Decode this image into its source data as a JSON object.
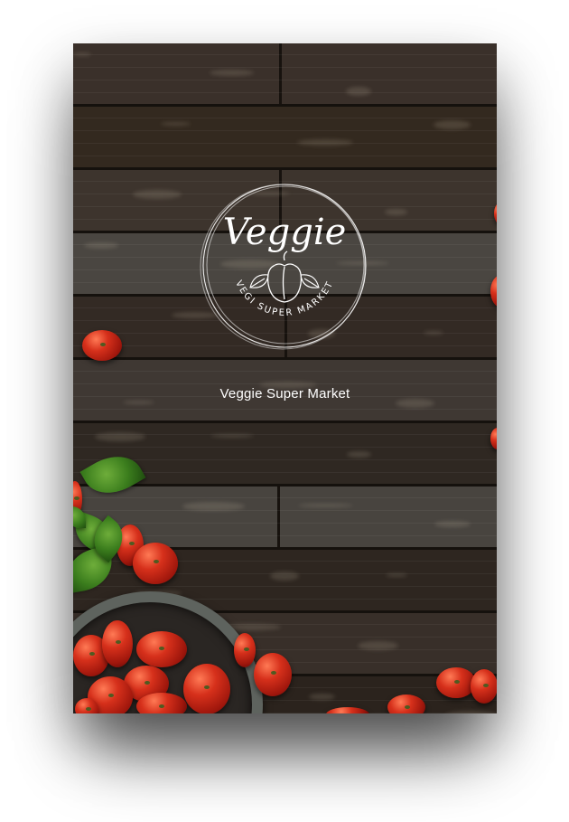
{
  "app": {
    "logo_script": "Veggie",
    "logo_arc": "VEGI SUPER MARKET",
    "tagline": "Veggie Super Market"
  },
  "colors": {
    "wood_dark": "#2e2620",
    "plank_seam": "#15110d",
    "tomato_red": "#d6301b",
    "basil_green": "#3b7d1d",
    "text": "#ffffff"
  },
  "icons": [
    "pepper-icon",
    "leaf-icon"
  ]
}
